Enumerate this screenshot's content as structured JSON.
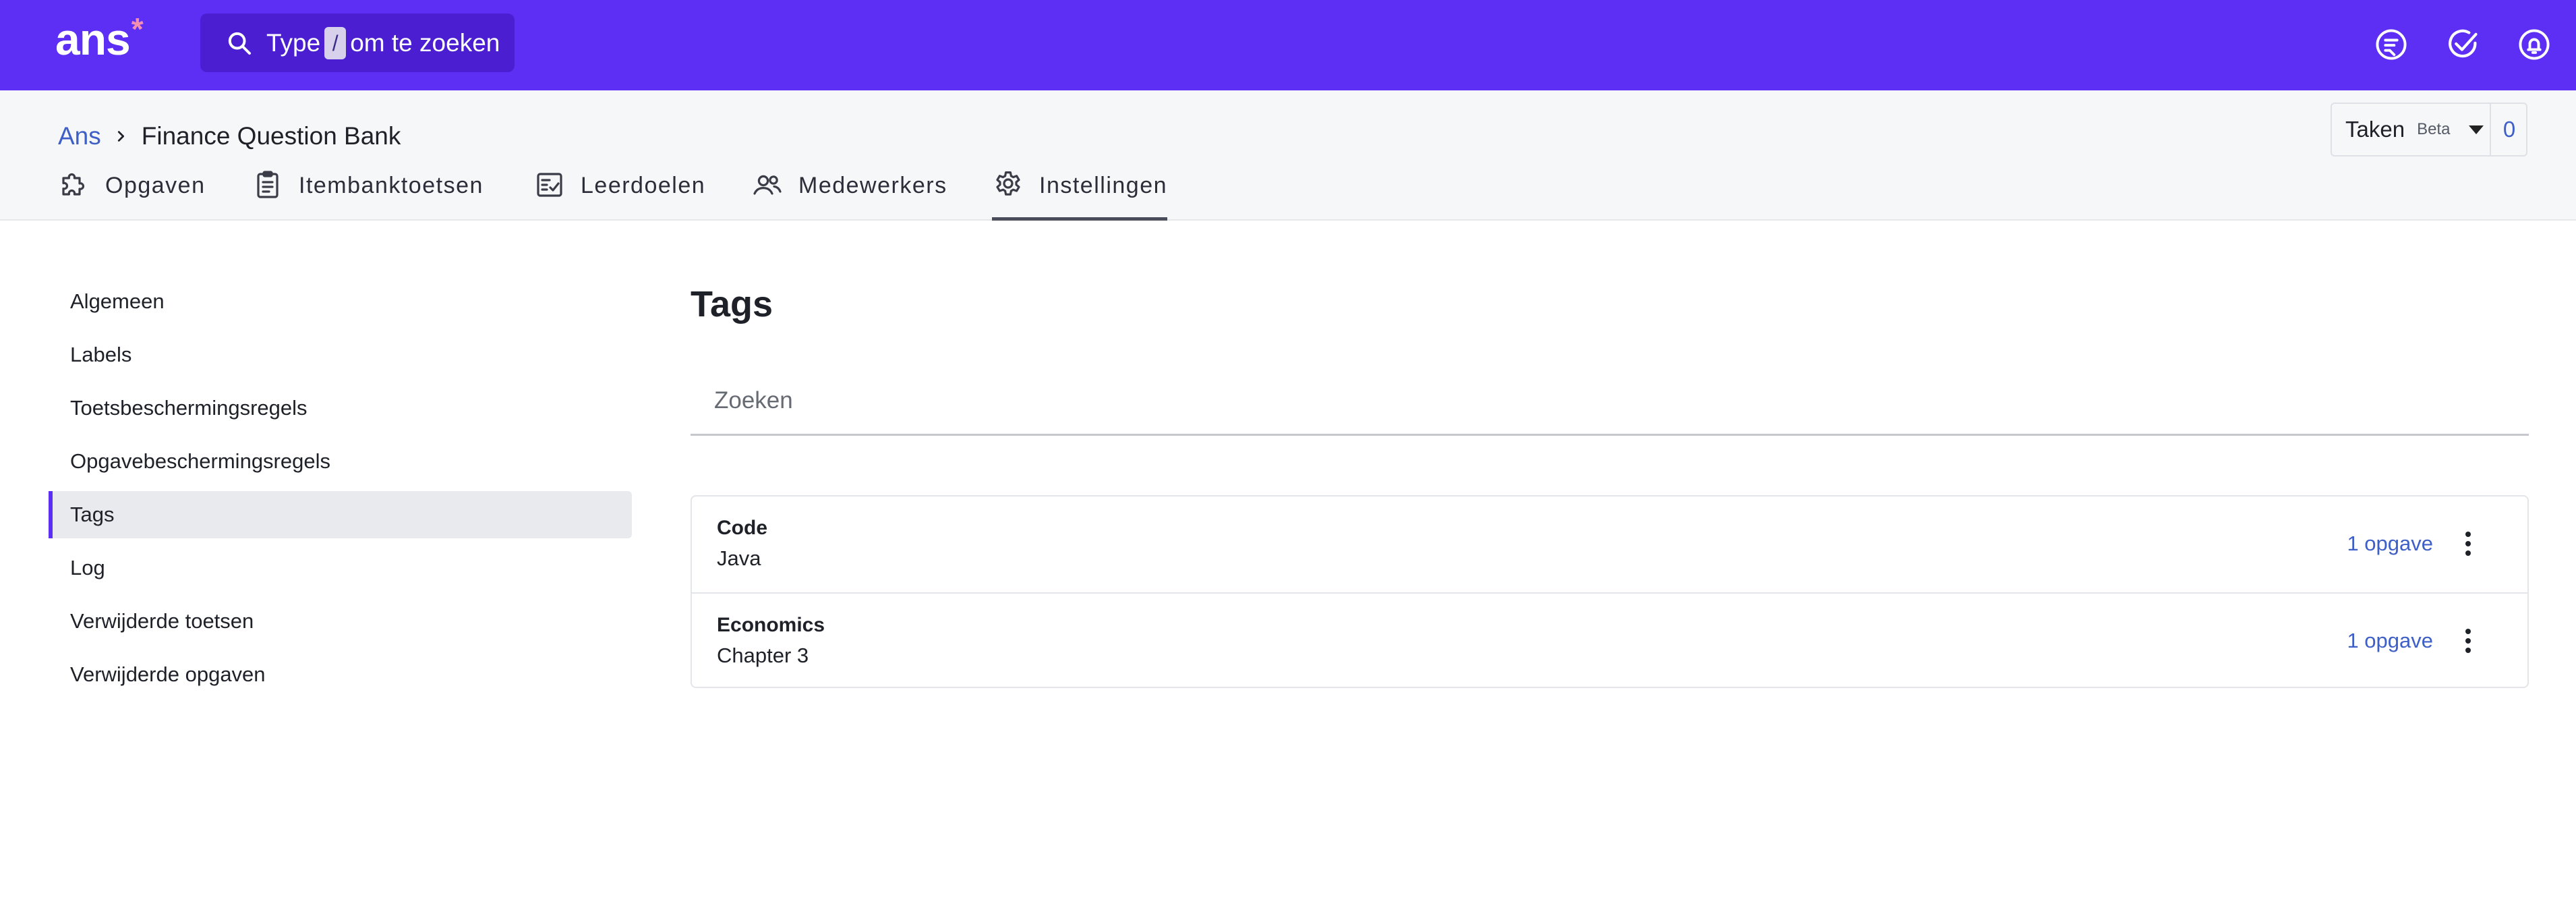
{
  "app": {
    "logo_text": "ans",
    "logo_mark": "*",
    "accent_color": "#5d2ff5",
    "logo_star_color": "#f58fb2"
  },
  "search": {
    "prefix": "Type",
    "key": "/",
    "suffix": "om te zoeken",
    "icon": "search-icon"
  },
  "top_icons": [
    "feedback-icon",
    "check-circle-icon",
    "bell-icon",
    "help-icon",
    "user-icon"
  ],
  "breadcrumb": {
    "root": "Ans",
    "current": "Finance Question Bank"
  },
  "tasks": {
    "label": "Taken",
    "badge": "Beta",
    "count": "0"
  },
  "tabs": [
    {
      "label": "Opgaven",
      "icon": "puzzle-icon"
    },
    {
      "label": "Itembanktoetsen",
      "icon": "clipboard-icon"
    },
    {
      "label": "Leerdoelen",
      "icon": "checklist-icon"
    },
    {
      "label": "Medewerkers",
      "icon": "people-icon"
    },
    {
      "label": "Instellingen",
      "icon": "gear-icon",
      "active": true
    }
  ],
  "sidebar": {
    "items": [
      {
        "label": "Algemeen"
      },
      {
        "label": "Labels"
      },
      {
        "label": "Toetsbeschermingsregels"
      },
      {
        "label": "Opgavebeschermingsregels"
      },
      {
        "label": "Tags",
        "active": true
      },
      {
        "label": "Log"
      },
      {
        "label": "Verwijderde toetsen"
      },
      {
        "label": "Verwijderde opgaven"
      }
    ]
  },
  "main": {
    "title": "Tags",
    "filter_placeholder": "Zoeken",
    "tags": [
      {
        "name": "Code",
        "value": "Java",
        "count": "1 opgave"
      },
      {
        "name": "Economics",
        "value": "Chapter 3",
        "count": "1 opgave"
      }
    ]
  }
}
